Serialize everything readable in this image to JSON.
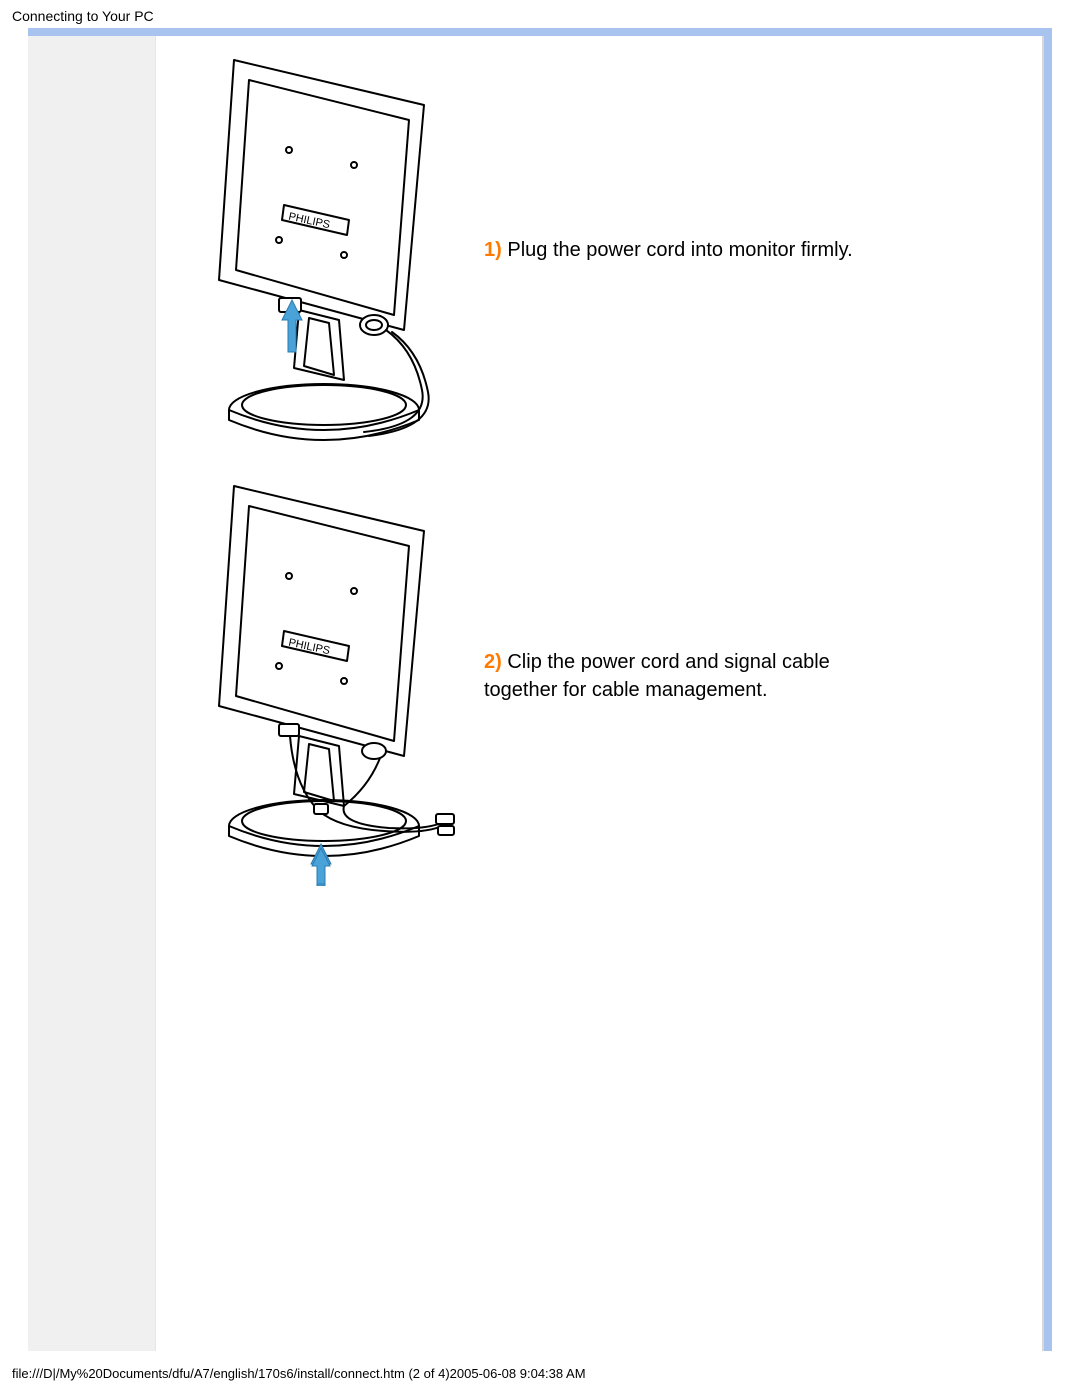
{
  "header": {
    "title": "Connecting to Your PC"
  },
  "steps": [
    {
      "num": "1)",
      "text": "Plug the power cord into monitor firmly."
    },
    {
      "num": "2)",
      "text": "Clip the power cord and signal cable together for cable management."
    }
  ],
  "footer": {
    "text": "file:///D|/My%20Documents/dfu/A7/english/170s6/install/connect.htm (2 of 4)2005-06-08 9:04:38 AM"
  },
  "colors": {
    "accent_orange": "#ff7b00",
    "frame_blue": "#a9c3ef",
    "arrow_blue": "#4aa3d8"
  }
}
